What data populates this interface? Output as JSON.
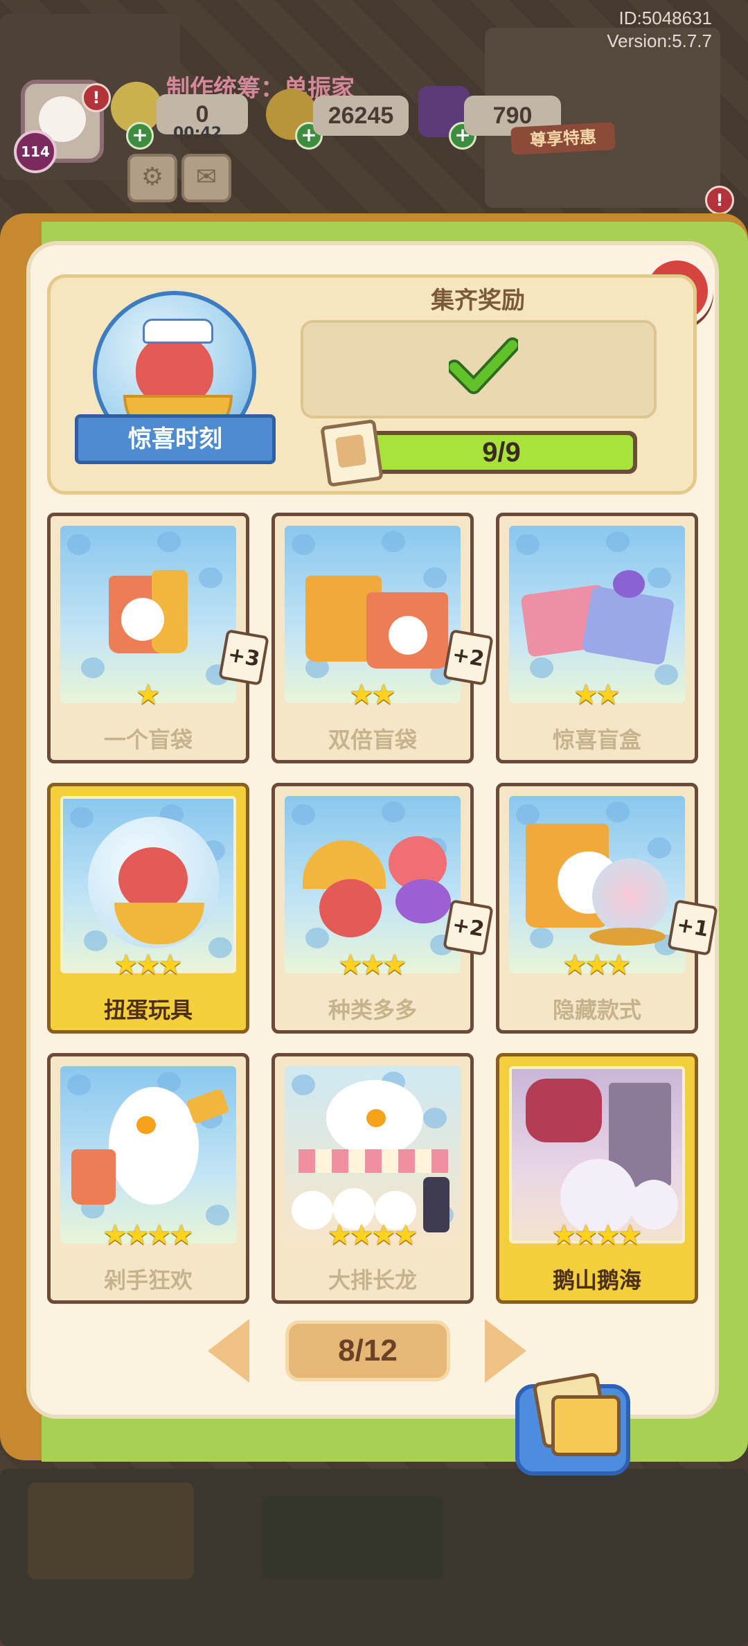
{
  "hud": {
    "user_id": "ID:5048631",
    "version": "Version:5.7.7",
    "credit": "制作统筹：单振家",
    "level": "114",
    "energy": "0",
    "energy_timer": "00:42",
    "coins": "26245",
    "gems": "790",
    "promo_label": "尊享特惠",
    "alert_mark": "!"
  },
  "collection": {
    "title": "惊喜时刻",
    "reward_title": "集齐奖励",
    "reward_claimed": true,
    "progress_text": "9/9",
    "progress_value": 1.0,
    "close_label": "×"
  },
  "cards": [
    {
      "name": "一个盲袋",
      "stars": 1,
      "bonus": "+3",
      "gold": false
    },
    {
      "name": "双倍盲袋",
      "stars": 2,
      "bonus": "+2",
      "gold": false
    },
    {
      "name": "惊喜盲盒",
      "stars": 2,
      "bonus": "",
      "gold": false
    },
    {
      "name": "扭蛋玩具",
      "stars": 3,
      "bonus": "",
      "gold": true
    },
    {
      "name": "种类多多",
      "stars": 3,
      "bonus": "+2",
      "gold": false
    },
    {
      "name": "隐藏款式",
      "stars": 3,
      "bonus": "+1",
      "gold": false
    },
    {
      "name": "剁手狂欢",
      "stars": 4,
      "bonus": "",
      "gold": false
    },
    {
      "name": "大排长龙",
      "stars": 4,
      "bonus": "",
      "gold": false
    },
    {
      "name": "鹅山鹅海",
      "stars": 4,
      "bonus": "",
      "gold": true
    }
  ],
  "pagination": {
    "current": 8,
    "total": 12,
    "label": "8/12"
  },
  "colors": {
    "book_orange": "#c6892f",
    "book_green": "#a9cf54",
    "close_red": "#d6443f",
    "progress_green": "#a6e33b",
    "ribbon_blue": "#4f8bd0"
  }
}
